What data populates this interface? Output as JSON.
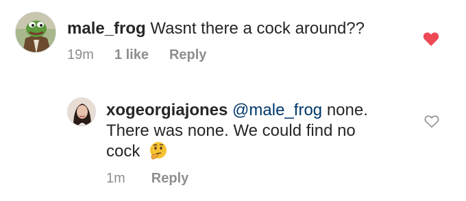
{
  "comments": [
    {
      "username": "male_frog",
      "text": "Wasnt there a cock around??",
      "time": "19m",
      "likes": "1 like",
      "reply_label": "Reply",
      "liked": true,
      "avatar_icon": "frog-avatar"
    },
    {
      "username": "xogeorgiajones",
      "mention": "@male_frog",
      "text_line1": "none.",
      "text_line2": "There was none. We could find no",
      "text_line3": "cock",
      "emoji": "thinking-face-emoji",
      "time": "1m",
      "reply_label": "Reply",
      "liked": false,
      "avatar_icon": "woman-avatar"
    }
  ],
  "colors": {
    "like_active": "#ed4956",
    "like_inactive": "#8e8e8e",
    "mention": "#00376b",
    "meta_text": "#8e8e8e"
  }
}
